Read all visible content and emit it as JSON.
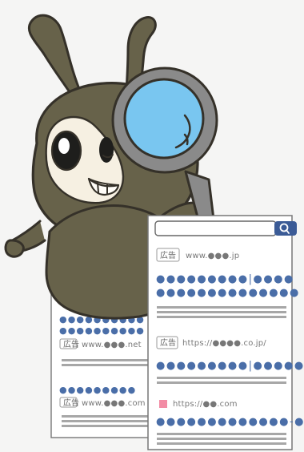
{
  "search": {
    "placeholder": ""
  },
  "back_card": {
    "result_1_title": "●●●●●●●●●●",
    "result_2_badge": "広告",
    "result_2_url": "www.●●●.net",
    "result_3_title": "●●●●●●●●●",
    "result_3_badge": "広告",
    "result_3_url": "www.●●●.com"
  },
  "front_card": {
    "result_1_badge": "広告",
    "result_1_url": "www.●●●.jp",
    "result_1_title_line1": "●●●●●●●●●|●●●●",
    "result_1_title_line2": "●●●●●●●●●●●●●●",
    "result_2_badge": "広告",
    "result_2_url": "https://●●●●.co.jp/",
    "result_2_title": "●●●●●●●●●|●●●●●",
    "result_3_url": "https://●●.com",
    "result_3_title": "●●●●●●●●●●●●●-●●"
  },
  "colors": {
    "creature": "#67624a",
    "creature_outline": "#353129",
    "face": "#f6f0e2",
    "lens": "#79c6f0",
    "result_dot": "#4a6ea8",
    "favicon": "#f28ca5"
  },
  "icons": {
    "search": "search-icon",
    "favicon": "favicon-icon"
  }
}
